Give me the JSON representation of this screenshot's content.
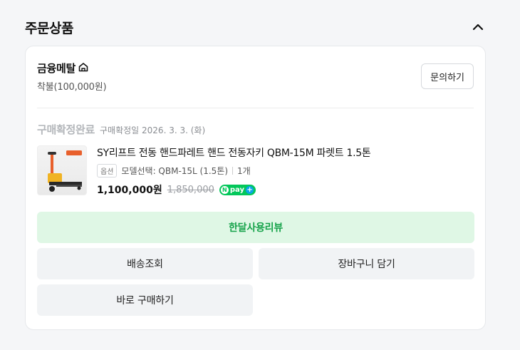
{
  "section": {
    "title": "주문상품",
    "collapse_icon": "chevron-up-icon"
  },
  "seller": {
    "name": "금융메탈",
    "store_icon": "store-icon",
    "payment": "착불(100,000원)",
    "inquiry_label": "문의하기"
  },
  "order_status": {
    "label": "구매확정완료",
    "date": "구매확정일 2026. 3. 3. (화)"
  },
  "product": {
    "name": "SY리프트 전동 핸드파레트 핸드 전동자키 QBM-15M 파렛트 1.5톤",
    "option_badge": "옵션",
    "option_text": "모델선택: QBM-15L (1.5톤)",
    "quantity": "1개",
    "price": "1,100,000원",
    "original_price": "1,850,000",
    "npay_label": "pay",
    "npay_n": "N",
    "npay_plus": "+"
  },
  "actions": {
    "review": "한달사용리뷰",
    "track": "배송조회",
    "cart": "장바구니 담기",
    "buy_again": "바로 구매하기"
  },
  "colors": {
    "review_bg": "#dff7e5",
    "review_text": "#16a34a",
    "npay": "#03c75a"
  }
}
